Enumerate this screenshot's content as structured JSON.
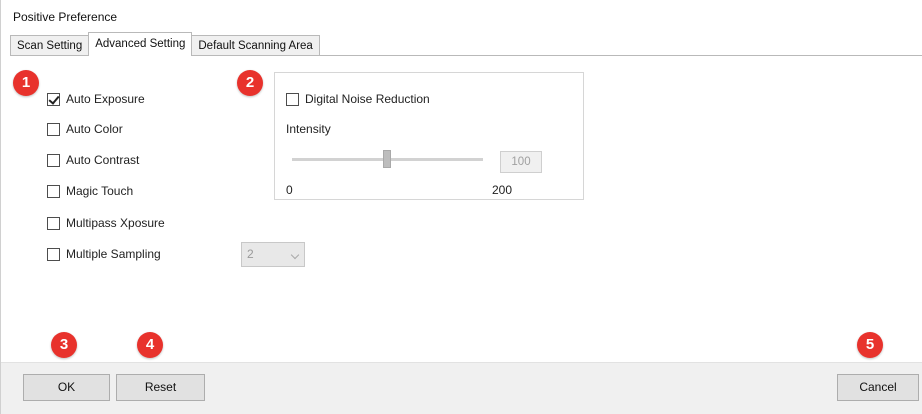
{
  "window": {
    "title": "Positive Preference"
  },
  "tabs": [
    {
      "label": "Scan Setting"
    },
    {
      "label": "Advanced Setting"
    },
    {
      "label": "Default Scanning Area"
    }
  ],
  "active_tab": "Advanced Setting",
  "callouts": [
    "1",
    "2",
    "3",
    "4",
    "5"
  ],
  "options": [
    {
      "label": "Auto Exposure",
      "checked": true
    },
    {
      "label": "Auto Color",
      "checked": false
    },
    {
      "label": "Auto Contrast",
      "checked": false
    },
    {
      "label": "Magic Touch",
      "checked": false
    },
    {
      "label": "Multipass Xposure",
      "checked": false
    },
    {
      "label": "Multiple Sampling",
      "checked": false
    }
  ],
  "sampling_select": {
    "value": "2"
  },
  "noise_reduction": {
    "label": "Digital Noise Reduction",
    "checked": false,
    "intensity_label": "Intensity",
    "value": "100",
    "min_label": "0",
    "max_label": "200"
  },
  "buttons": {
    "ok": "OK",
    "reset": "Reset",
    "cancel": "Cancel"
  },
  "colors": {
    "callout": "#e8322c",
    "footer": "#f0f0f0",
    "button": "#e1e1e1"
  }
}
